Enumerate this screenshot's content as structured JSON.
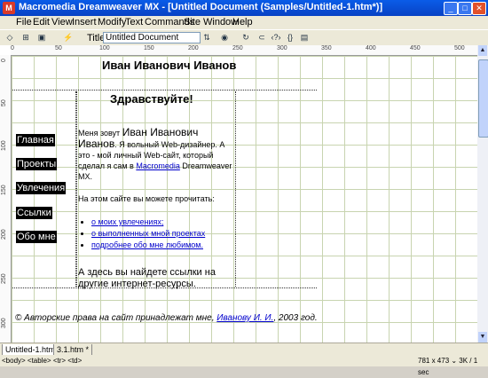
{
  "window": {
    "title": "Macromedia Dreamweaver MX - [Untitled Document (Samples/Untitled-1.htm*)]",
    "app_icon": "M"
  },
  "menu": [
    "File",
    "Edit",
    "View",
    "Insert",
    "Modify",
    "Text",
    "Commands",
    "Site",
    "Window",
    "Help"
  ],
  "toolbar": {
    "title_label": "Title:",
    "title_value": "Untitled Document"
  },
  "ruler": {
    "h": [
      "0",
      "50",
      "100",
      "150",
      "200",
      "250",
      "300",
      "350",
      "400",
      "450",
      "500"
    ],
    "v": [
      "0",
      "50",
      "100",
      "150",
      "200",
      "250",
      "300"
    ]
  },
  "page": {
    "name": "Иван Иванович Иванов",
    "greeting": "Здравствуйте!",
    "nav": [
      "Главная",
      "Проекты",
      "Увлечения",
      "Ссылки",
      "Обо мне"
    ],
    "intro_1": "Меня зовут ",
    "intro_name": "Иван Иванович Иванов",
    "intro_2": ". Я вольный Web-дизайнер. А это - мой личный Web-сайт, который сделал я сам в ",
    "intro_link": "Macromedia",
    "intro_3": " Dreamweaver MX.",
    "can_read": "На этом сайте вы можете прочитать:",
    "links": [
      "о моих увлечениях;",
      "о выполненных мной проектах",
      "подробнее обо мне любимом."
    ],
    "outro": "А здесь вы найдете ссылки на другие интернет-ресурсы.",
    "copyright_1": "© Авторские права на сайт принадлежат мне, ",
    "copyright_link": "Иванову И. И.",
    "copyright_2": ", 2003 год."
  },
  "tabs": [
    "Untitled-1.htm *",
    "3.1.htm *"
  ],
  "status": {
    "tags": "<body> <table> <tr> <td>",
    "size": "781 x 473 ⌄ 3K / 1 sec"
  }
}
